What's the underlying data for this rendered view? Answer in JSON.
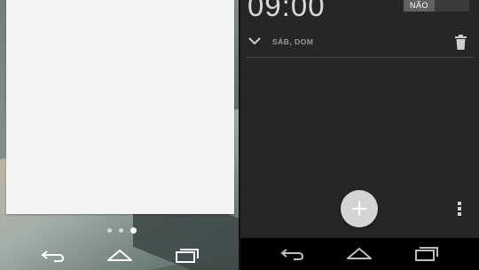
{
  "left": {
    "pages": {
      "count": 3,
      "active_index": 2
    }
  },
  "right": {
    "alarm": {
      "time": "09:00",
      "toggle_label": "NÃO",
      "days": "SÁB, DOM"
    }
  },
  "icons": {
    "back": "back-arrow-icon",
    "home": "home-icon",
    "recents": "recent-apps-icon",
    "add": "plus-icon",
    "delete": "trash-icon",
    "expand": "chevron-down-icon",
    "menu": "overflow-menu-icon"
  },
  "colors": {
    "clock_bg": "#262626",
    "fab_bg": "#d4d4d4",
    "text_primary": "#d8d8d8"
  }
}
